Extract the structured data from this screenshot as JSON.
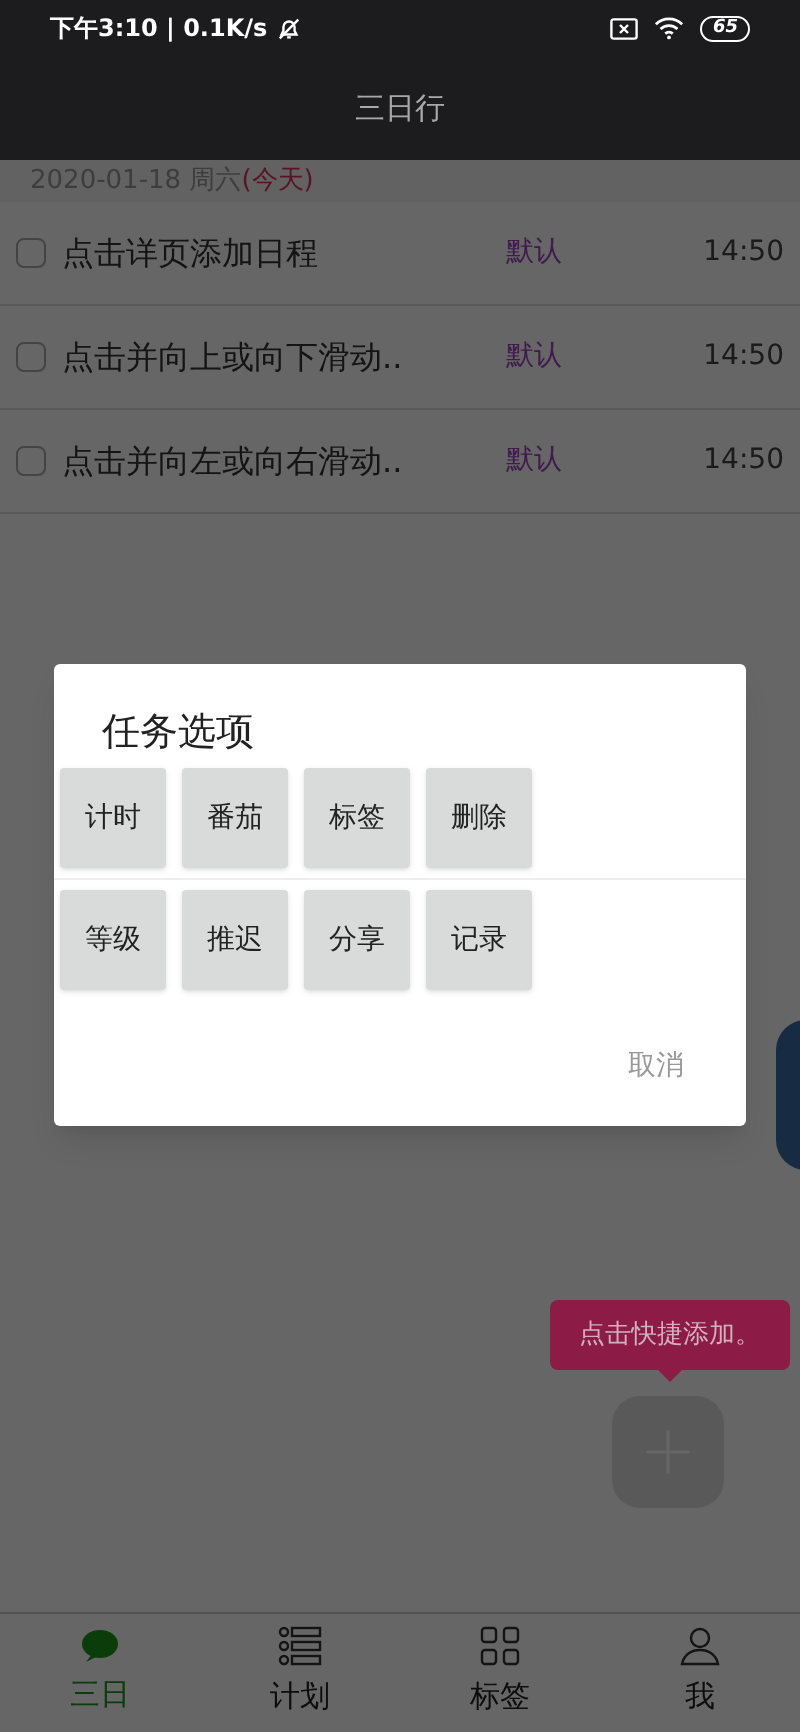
{
  "status_bar": {
    "time_speed": "下午3:10 | 0.1K/s",
    "battery": "65"
  },
  "header": {
    "title": "三日行"
  },
  "date_row": {
    "date": "2020-01-18 周六",
    "today": "(今天)"
  },
  "tasks": [
    {
      "title": "点击详页添加日程",
      "tag": "默认",
      "time": "14:50",
      "checked": false
    },
    {
      "title": "点击并向上或向下滑动..",
      "tag": "默认",
      "time": "14:50",
      "checked": false
    },
    {
      "title": "点击并向左或向右滑动..",
      "tag": "默认",
      "time": "14:50",
      "checked": false
    }
  ],
  "dialog": {
    "title": "任务选项",
    "option_rows": [
      [
        "计时",
        "番茄",
        "标签",
        "删除"
      ],
      [
        "等级",
        "推迟",
        "分享",
        "记录"
      ]
    ],
    "cancel": "取消"
  },
  "tooltip": {
    "text": "点击快捷添加。"
  },
  "tabs": [
    {
      "label": "三日",
      "kind": "chat",
      "selected": true
    },
    {
      "label": "计划",
      "kind": "list",
      "selected": false
    },
    {
      "label": "标签",
      "kind": "grid",
      "selected": false
    },
    {
      "label": "我",
      "kind": "person",
      "selected": false
    }
  ]
}
